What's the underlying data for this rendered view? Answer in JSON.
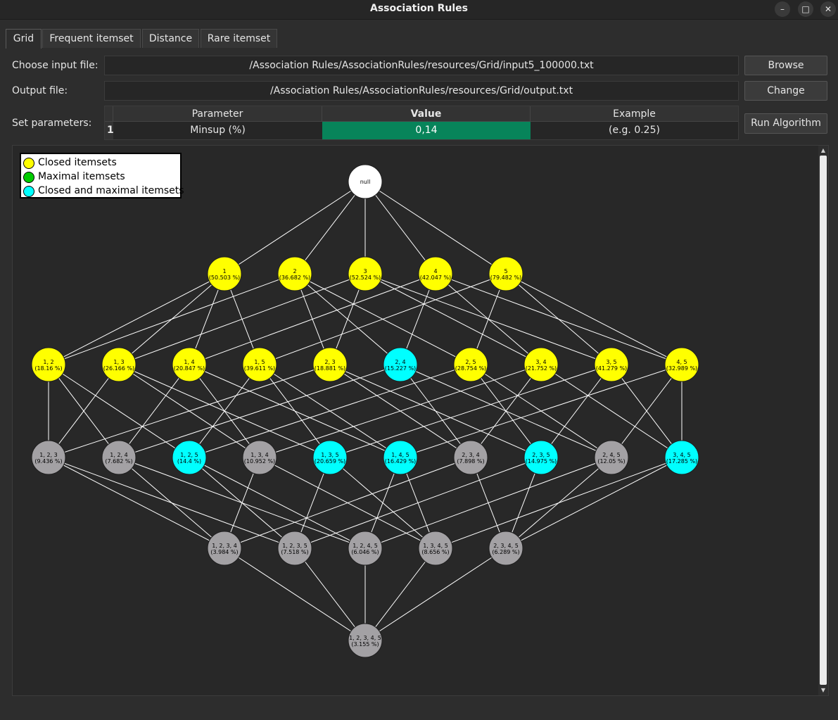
{
  "window": {
    "title": "Association Rules"
  },
  "tabs": [
    {
      "label": "Grid",
      "active": true
    },
    {
      "label": "Frequent itemset",
      "active": false
    },
    {
      "label": "Distance",
      "active": false
    },
    {
      "label": "Rare itemset",
      "active": false
    }
  ],
  "form": {
    "input_label": "Choose input file:",
    "input_path": "/Association Rules/AssociationRules/resources/Grid/input5_100000.txt",
    "browse_label": "Browse",
    "output_label": "Output file:",
    "output_path": "/Association Rules/AssociationRules/resources/Grid/output.txt",
    "change_label": "Change",
    "params_label": "Set parameters:",
    "run_label": "Run Algorithm"
  },
  "params_table": {
    "headers": [
      "Parameter",
      "Value",
      "Example"
    ],
    "rows": [
      {
        "index": "1",
        "parameter": "Minsup (%)",
        "value": "0,14",
        "example": "(e.g. 0.25)"
      }
    ],
    "value_cell_color": "#07845a"
  },
  "legend": [
    {
      "label": "Closed itemsets",
      "color": "#ffff00"
    },
    {
      "label": "Maximal itemsets",
      "color": "#00cc00"
    },
    {
      "label": "Closed and maximal itemsets",
      "color": "#00ffff"
    }
  ],
  "colors": {
    "closed": "#ffff00",
    "maximal": "#00cc00",
    "closed_maximal": "#00ffff",
    "none": "#a3a1a4",
    "root": "#ffffff"
  },
  "lattice": {
    "root": {
      "label": "null"
    },
    "levels": [
      [
        {
          "items": "1",
          "support": "(50.503 %)",
          "type": "closed"
        },
        {
          "items": "2",
          "support": "(36.682 %)",
          "type": "closed"
        },
        {
          "items": "3",
          "support": "(52.524 %)",
          "type": "closed"
        },
        {
          "items": "4",
          "support": "(42.047 %)",
          "type": "closed"
        },
        {
          "items": "5",
          "support": "(79.482 %)",
          "type": "closed"
        }
      ],
      [
        {
          "items": "1, 2",
          "support": "(18.16 %)",
          "type": "closed"
        },
        {
          "items": "1, 3",
          "support": "(26.166 %)",
          "type": "closed"
        },
        {
          "items": "1, 4",
          "support": "(20.847 %)",
          "type": "closed"
        },
        {
          "items": "1, 5",
          "support": "(39.611 %)",
          "type": "closed"
        },
        {
          "items": "2, 3",
          "support": "(18.881 %)",
          "type": "closed"
        },
        {
          "items": "2, 4",
          "support": "(15.227 %)",
          "type": "closed_maximal"
        },
        {
          "items": "2, 5",
          "support": "(28.754 %)",
          "type": "closed"
        },
        {
          "items": "3, 4",
          "support": "(21.752 %)",
          "type": "closed"
        },
        {
          "items": "3, 5",
          "support": "(41.279 %)",
          "type": "closed"
        },
        {
          "items": "4, 5",
          "support": "(32.989 %)",
          "type": "closed"
        }
      ],
      [
        {
          "items": "1, 2, 3",
          "support": "(9.436 %)",
          "type": "none"
        },
        {
          "items": "1, 2, 4",
          "support": "(7.682 %)",
          "type": "none"
        },
        {
          "items": "1, 2, 5",
          "support": "(14.4 %)",
          "type": "closed_maximal"
        },
        {
          "items": "1, 3, 4",
          "support": "(10.952 %)",
          "type": "none"
        },
        {
          "items": "1, 3, 5",
          "support": "(20.659 %)",
          "type": "closed_maximal"
        },
        {
          "items": "1, 4, 5",
          "support": "(16.429 %)",
          "type": "closed_maximal"
        },
        {
          "items": "2, 3, 4",
          "support": "(7.898 %)",
          "type": "none"
        },
        {
          "items": "2, 3, 5",
          "support": "(14.975 %)",
          "type": "closed_maximal"
        },
        {
          "items": "2, 4, 5",
          "support": "(12.05 %)",
          "type": "none"
        },
        {
          "items": "3, 4, 5",
          "support": "(17.285 %)",
          "type": "closed_maximal"
        }
      ],
      [
        {
          "items": "1, 2, 3, 4",
          "support": "(3.984 %)",
          "type": "none"
        },
        {
          "items": "1, 2, 3, 5",
          "support": "(7.518 %)",
          "type": "none"
        },
        {
          "items": "1, 2, 4, 5",
          "support": "(6.046 %)",
          "type": "none"
        },
        {
          "items": "1, 3, 4, 5",
          "support": "(8.656 %)",
          "type": "none"
        },
        {
          "items": "2, 3, 4, 5",
          "support": "(6.289 %)",
          "type": "none"
        }
      ],
      [
        {
          "items": "1, 2, 3, 4, 5",
          "support": "(3.155 %)",
          "type": "none"
        }
      ]
    ]
  }
}
